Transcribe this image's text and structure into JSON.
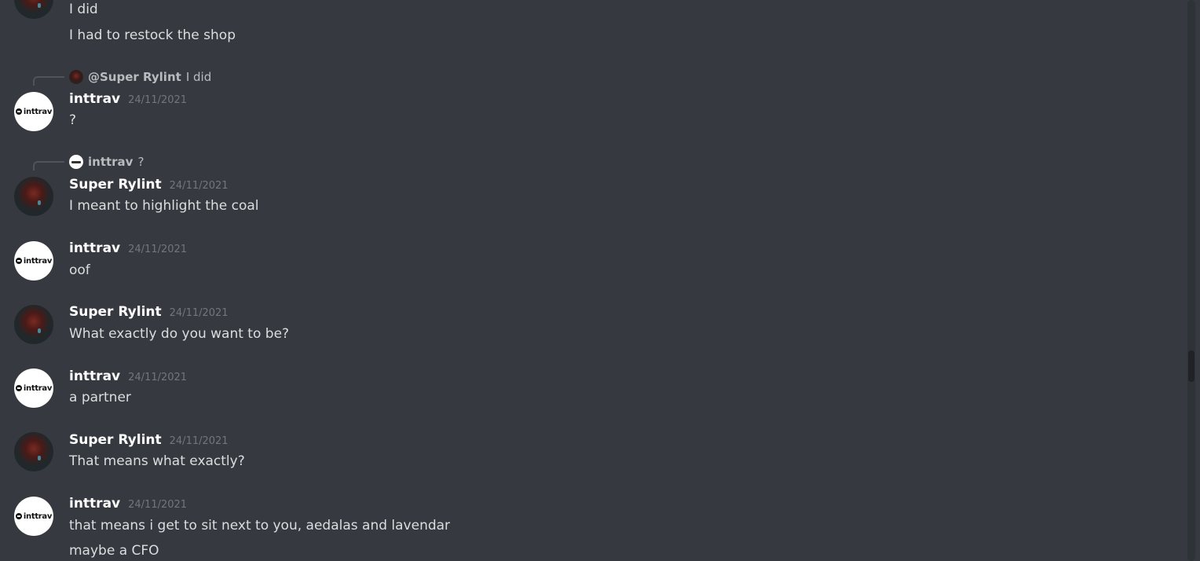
{
  "messages": [
    {
      "author": "",
      "lines": [
        "I did",
        "I had to restock the shop"
      ]
    },
    {
      "reply": {
        "name": "@Super Rylint",
        "text": "I did"
      },
      "author": "inttrav",
      "timestamp": "24/11/2021",
      "lines": [
        "?"
      ]
    },
    {
      "reply": {
        "name": "inttrav",
        "text": "?"
      },
      "author": "Super Rylint",
      "timestamp": "24/11/2021",
      "lines": [
        "I meant to highlight the coal"
      ]
    },
    {
      "author": "inttrav",
      "timestamp": "24/11/2021",
      "lines": [
        "oof"
      ]
    },
    {
      "author": "Super Rylint",
      "timestamp": "24/11/2021",
      "lines": [
        "What exactly do you want to be?"
      ]
    },
    {
      "author": "inttrav",
      "timestamp": "24/11/2021",
      "lines": [
        "a partner"
      ]
    },
    {
      "author": "Super Rylint",
      "timestamp": "24/11/2021",
      "lines": [
        "That means what exactly?"
      ]
    },
    {
      "author": "inttrav",
      "timestamp": "24/11/2021",
      "lines": [
        "that means i get to sit next to you, aedalas and lavendar",
        "maybe a CFO"
      ]
    }
  ],
  "avatars": {
    "inttrav_logo_text": "inttrav"
  },
  "colors": {
    "background": "#36393f",
    "text": "#dcddde",
    "author": "#ffffff",
    "timestamp": "#72767d",
    "reply_text": "#b9bbbe"
  },
  "icons": {
    "scrollbar": "scrollbar-thumb"
  }
}
